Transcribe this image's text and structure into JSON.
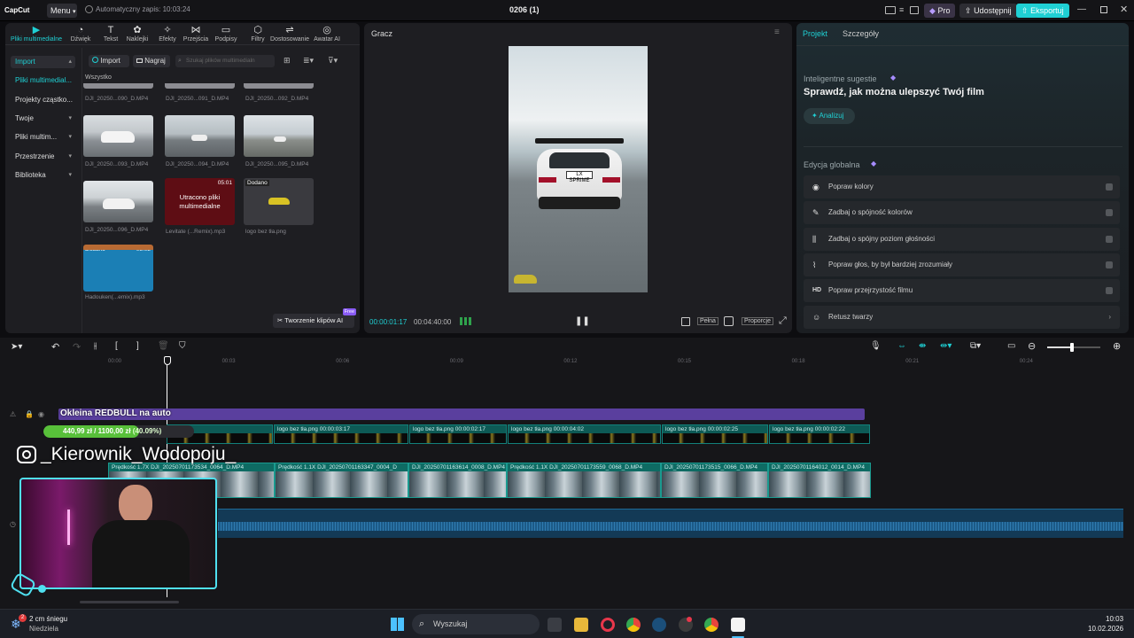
{
  "titlebar": {
    "app_logo": "CapCut",
    "menu_label": "Menu",
    "autosave": "Automatyczny zapis: 10:03:24",
    "project_name": "0206 (1)",
    "pro_label": "Pro",
    "share_label": "Udostępnij",
    "export_label": "Eksportuj",
    "accent": "#1fd0d4"
  },
  "toolbar": {
    "items": [
      {
        "label": "Pliki multimedialne",
        "icon": "media-icon"
      },
      {
        "label": "Dźwięk",
        "icon": "audio-icon"
      },
      {
        "label": "Tekst",
        "icon": "text-icon"
      },
      {
        "label": "Naklejki",
        "icon": "sticker-icon"
      },
      {
        "label": "Efekty",
        "icon": "effects-icon"
      },
      {
        "label": "Przejścia",
        "icon": "transitions-icon"
      },
      {
        "label": "Podpisy",
        "icon": "captions-icon"
      },
      {
        "label": "Filtry",
        "icon": "filters-icon"
      },
      {
        "label": "Dostosowanie",
        "icon": "adjust-icon"
      },
      {
        "label": "Awatar AI",
        "icon": "avatar-icon"
      }
    ]
  },
  "sidebar": {
    "items": [
      {
        "label": "Import"
      },
      {
        "label": "Pliki multimedial..."
      },
      {
        "label": "Projekty cząstko..."
      },
      {
        "label": "Twoje"
      },
      {
        "label": "Pliki multim..."
      },
      {
        "label": "Przestrzenie"
      },
      {
        "label": "Biblioteka"
      }
    ]
  },
  "media": {
    "import_button": "Import",
    "record_button": "Nagraj",
    "search_placeholder": "Szukaj plików multimedialn",
    "filter_all": "Wszystko",
    "top_row": [
      "DJI_20250...090_D.MP4",
      "DJI_20250...091_D.MP4",
      "DJI_20250...092_D.MP4"
    ],
    "items": [
      {
        "name": "DJI_20250...093_D.MP4"
      },
      {
        "name": "DJI_20250...094_D.MP4"
      },
      {
        "name": "DJI_20250...095_D.MP4"
      },
      {
        "name": "DJI_20250...096_D.MP4"
      },
      {
        "name": "Levitate (...Remix).mp3",
        "missing_text": "Utracono pliki multimedialne",
        "duration": "05:01"
      },
      {
        "name": "logo bez tła.png",
        "badge": "Dodano"
      },
      {
        "name": "Hadouken(...emix).mp3",
        "badge": "Dodano",
        "duration": "05:02"
      }
    ],
    "ai_button": "Tworzenie klipów AI",
    "ai_badge": "Free"
  },
  "player": {
    "title": "Gracz",
    "current_time": "00:00:01:17",
    "total_time": "00:04:40:00",
    "full_label": "Pełna",
    "ratio_label": "Proporcje",
    "plate": "LX SPRIME"
  },
  "right": {
    "tab_project": "Projekt",
    "tab_details": "Szczegóły",
    "suggest_title": "Inteligentne sugestie",
    "suggest_heading": "Sprawdź, jak można ulepszyć Twój film",
    "analyze_button": "Analizuj",
    "global_title": "Edycja globalna",
    "rows": [
      {
        "label": "Popraw kolory",
        "icon": "color-icon"
      },
      {
        "label": "Zadbaj o spójność kolorów",
        "icon": "wand-icon"
      },
      {
        "label": "Zadbaj o spójny poziom głośności",
        "icon": "volume-icon"
      },
      {
        "label": "Popraw głos, by był bardziej zrozumiały",
        "icon": "voice-icon"
      },
      {
        "label": "Popraw przejrzystość filmu",
        "icon": "hd-icon"
      },
      {
        "label": "Retusz twarzy",
        "icon": "face-icon"
      }
    ]
  },
  "timeline": {
    "ticks": [
      "00:00",
      "00:03",
      "00:06",
      "00:09",
      "00:12",
      "00:15",
      "00:18",
      "00:21",
      "00:24"
    ],
    "title_clip": "Okleina REDBULL na auto",
    "goal_current": "440,99 zł",
    "goal_sep": "/",
    "goal_target": "1100,00 zł",
    "goal_percent": "(40.09%)",
    "goal_fraction": 0.4009,
    "instagram": "_Kierownik_Wodopoju_",
    "sticker_clips": [
      {
        "label": "11"
      },
      {
        "label": "logo bez tła.png  00:00:03:17"
      },
      {
        "label": "logo bez tła.png  00:00:02:17"
      },
      {
        "label": "logo bez tła.png  00:00:04:02"
      },
      {
        "label": "logo bez tła.png  00:00:02:25"
      },
      {
        "label": "logo bez tła.png  00:00:02:22"
      }
    ],
    "video_clips": [
      {
        "label": "Prędkość 1.7X  DJI_20250701173534_0064_D.MP4"
      },
      {
        "label": "Prędkość 1.1X  DJI_20250701163347_0004_D"
      },
      {
        "label": "DJI_20250701163614_0008_D.MP4"
      },
      {
        "label": "Prędkość 1.1X  DJI_20250701173559_0068_D.MP4"
      },
      {
        "label": "DJI_20250701173515_0066_D.MP4"
      },
      {
        "label": "DJI_20250701164012_0014_D.MP4"
      }
    ]
  },
  "taskbar": {
    "weather_badge": "2",
    "weather": "2 cm śniegu",
    "day": "Niedziela",
    "search": "Wyszukaj",
    "time": "10:03",
    "date": "10.02.2026"
  }
}
